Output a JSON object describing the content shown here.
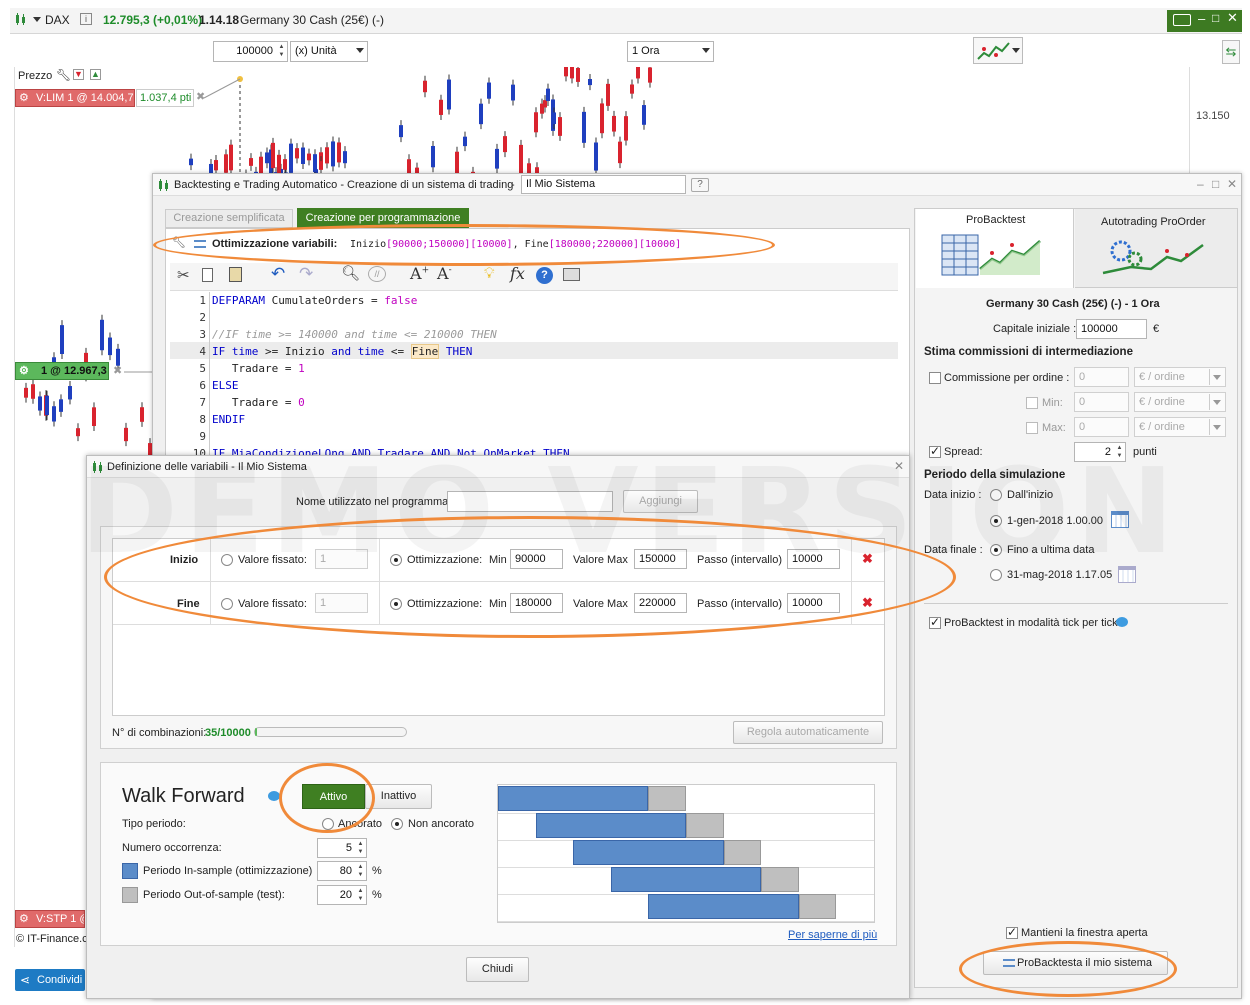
{
  "top_bar": {
    "instrument": "DAX",
    "price_change": "12.795,3 (+0,01%)",
    "time": "1.14.18",
    "product": "Germany 30 Cash (25€) (-)"
  },
  "toolbar2": {
    "quantity": "100000",
    "unit": "(x) Unità",
    "timeframe": "1 Ora"
  },
  "chart_side": {
    "prezzo_label": "Prezzo",
    "order_tag_lim": "V:LIM  1 @ 14.004,7",
    "order_tag_pts": "1.037,4 pti",
    "position_tag": "1 @ 12.967,3",
    "stop_tag": "V:STP  1 @",
    "copyright": "© IT-Finance.c",
    "share_label": "Condividi",
    "price_tick": "13.150"
  },
  "backtest_window": {
    "title": "Backtesting e Trading Automatico - Creazione di un sistema di trading",
    "system_name": "Il Mio Sistema",
    "tab_simple": "Creazione semplificata",
    "tab_program": "Creazione per programmazione",
    "opt_label": "Ottimizzazione variabili:",
    "opt_inizio_name": "Inizio",
    "opt_inizio_vals": "[90000;150000][10000]",
    "opt_sep": ", ",
    "opt_fine_name": "Fine",
    "opt_fine_vals": "[180000;220000][10000]"
  },
  "code": {
    "line_numbers": [
      "1",
      "2",
      "3",
      "4",
      "5",
      "6",
      "7",
      "8",
      "9",
      "10"
    ],
    "l1_kw": "DEFPARAM",
    "l1_name": " CumulateOrders = ",
    "l1_val": "false",
    "l3": "//IF time >= 140000 and time <= 210000 THEN",
    "l4_if": "IF",
    "l4_time1": " time ",
    "l4_ge": ">= Inizio ",
    "l4_and": "and",
    "l4_time2": " time ",
    "l4_le": "<= ",
    "l4_fine": "Fine",
    "l4_then": " THEN",
    "l5_name": "   Tradare = ",
    "l5_val": "1",
    "l6": "ELSE",
    "l7_name": "   Tradare = ",
    "l7_val": "0",
    "l8": "ENDIF",
    "l10": "IF MiaCondizioneLOng AND Tradare AND Not OnMarket THEN"
  },
  "var_dialog": {
    "title": "Definizione delle variabili - Il Mio Sistema",
    "name_label": "Nome utilizzato nel programma",
    "add_button": "Aggiungi",
    "rows": [
      {
        "name": "Inizio",
        "fixed_label": "Valore fissato:",
        "fixed_value": "1",
        "opt_label": "Ottimizzazione:",
        "min_label": "Min",
        "min": "90000",
        "max_label": "Valore Max",
        "max": "150000",
        "step_label": "Passo (intervallo)",
        "step": "10000"
      },
      {
        "name": "Fine",
        "fixed_label": "Valore fissato:",
        "fixed_value": "1",
        "opt_label": "Ottimizzazione:",
        "min_label": "Min",
        "min": "180000",
        "max_label": "Valore Max",
        "max": "220000",
        "step_label": "Passo (intervallo)",
        "step": "10000"
      }
    ],
    "combinations_label": "N° di combinazioni:",
    "combinations_value": "35/10000",
    "auto_button": "Regola automaticamente",
    "wf_title": "Walk Forward",
    "wf_active": "Attivo",
    "wf_inactive": "Inattivo",
    "period_type_label": "Tipo periodo:",
    "anchored": "Ancorato",
    "not_anchored": "Non ancorato",
    "occurrences_label": "Numero occorrenza:",
    "occurrences": "5",
    "insample_label": "Periodo In-sample (ottimizzazione)",
    "insample": "80",
    "outsample_label": "Periodo Out-of-sample (test):",
    "outsample": "20",
    "pct": "%",
    "learn_more": "Per saperne di più",
    "close_button": "Chiudi",
    "wf_segments": [
      {
        "start": 0.0,
        "in": 0.4,
        "out": 0.1
      },
      {
        "start": 0.1,
        "in": 0.4,
        "out": 0.1
      },
      {
        "start": 0.2,
        "in": 0.4,
        "out": 0.1
      },
      {
        "start": 0.3,
        "in": 0.4,
        "out": 0.1
      },
      {
        "start": 0.4,
        "in": 0.4,
        "out": 0.1
      }
    ]
  },
  "right_panel": {
    "tab_probacktest": "ProBacktest",
    "tab_autotrading": "Autotrading ProOrder",
    "instrument": "Germany 30 Cash (25€) (-) - 1 Ora",
    "capital_label": "Capitale iniziale :",
    "capital": "100000",
    "currency": "€",
    "commission_title": "Stima commissioni di intermediazione",
    "per_order_label": "Commissione per ordine :",
    "per_order": "0",
    "per_order_unit": "€ / ordine",
    "min_label": "Min:",
    "min": "0",
    "max_label": "Max:",
    "max": "0",
    "spread_label": "Spread:",
    "spread": "2",
    "spread_unit": "punti",
    "sim_period_title": "Periodo della simulazione",
    "start_label": "Data inizio :",
    "from_start": "Dall'inizio",
    "start_date": "1-gen-2018 1.00.00",
    "end_label": "Data finale :",
    "until_last": "Fino a ultima data",
    "end_date": "31-mag-2018 1.17.05",
    "tick_mode": "ProBacktest in modalità tick per tick",
    "keep_open": "Mantieni la finestra aperta",
    "run_button": "ProBacktesta il mio sistema"
  },
  "watermark": "DEMO VERSION",
  "colors": {
    "green_dark": "#3f7f22",
    "candle_red": "#d9232e",
    "candle_blue": "#1f3fbf",
    "wf_insample": "#5b8cc9",
    "wf_outsample": "#bfbfbf",
    "orange": "#f08a3a"
  }
}
